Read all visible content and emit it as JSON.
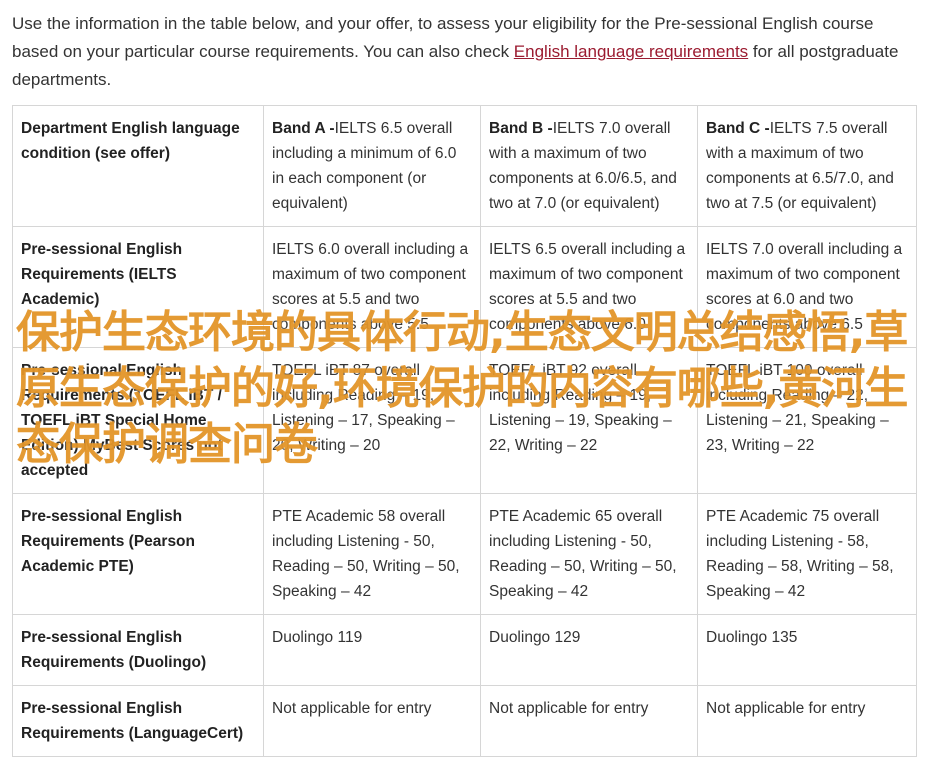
{
  "intro": {
    "text_before": "Use the information in the table below, and your offer, to assess your eligibility for the Pre-sessional English course based on your particular course requirements. You can also check ",
    "link": "English language requirements",
    "text_after": " for all postgraduate departments."
  },
  "table": {
    "header": {
      "row_label": "Department English language condition (see offer)",
      "bands": [
        {
          "label": "Band A -",
          "text": "IELTS 6.5 overall including a minimum of 6.0 in each component (or equivalent)"
        },
        {
          "label": "Band B -",
          "text": "IELTS 7.0 overall with a maximum of two components at 6.0/6.5, and two at 7.0 (or equivalent)"
        },
        {
          "label": "Band C -",
          "text": "IELTS 7.5 overall with a maximum of two components at 6.5/7.0, and two at 7.5 (or equivalent)"
        }
      ]
    },
    "rows": [
      {
        "label": "Pre-sessional English Requirements (IELTS Academic)",
        "cells": [
          "IELTS 6.0 overall including a maximum of two component scores at 5.5 and two components above 5.5",
          "IELTS 6.5 overall including a maximum of two component scores at 5.5 and two components above 6.0",
          "IELTS 7.0 overall including a maximum of two component scores at 6.0 and two components above 6.5"
        ]
      },
      {
        "label": "Pre-sessional English Requirements (TOEFL iBT / TOEFL iBT Special Home Edition) MyBest Scores not accepted",
        "cells": [
          "TOEFL iBT 87 overall including Reading – 19, Listening – 17, Speaking – 20, Writing – 20",
          "TOEFL iBT 92 overall including Reading – 19, Listening – 19, Speaking – 22, Writing – 22",
          "TOEFL iBT 100 overall including Reading – 22, Listening – 21, Speaking – 23, Writing – 22"
        ]
      },
      {
        "label": "Pre-sessional English Requirements (Pearson Academic PTE)",
        "cells": [
          "PTE Academic 58 overall including Listening - 50, Reading – 50, Writing – 50, Speaking – 42",
          "PTE Academic 65 overall including Listening - 50, Reading – 50, Writing – 50, Speaking – 42",
          "PTE Academic 75 overall including Listening - 58, Reading – 58, Writing – 58, Speaking – 42"
        ]
      },
      {
        "label": "Pre-sessional English Requirements (Duolingo)",
        "cells": [
          "Duolingo 119",
          "Duolingo 129",
          "Duolingo 135"
        ]
      },
      {
        "label": "Pre-sessional English Requirements (LanguageCert)",
        "cells": [
          "Not applicable for entry",
          "Not applicable for entry",
          "Not applicable for entry"
        ]
      }
    ]
  },
  "watermark": "保护生态环境的具体行动,生态文明总结感悟,草原生态保护的好,环境保护的内容有哪些,黄河生态保护调查问卷",
  "colors": {
    "link": "#9b1b30",
    "watermark": "#e29224",
    "border": "#d6d6d6"
  }
}
